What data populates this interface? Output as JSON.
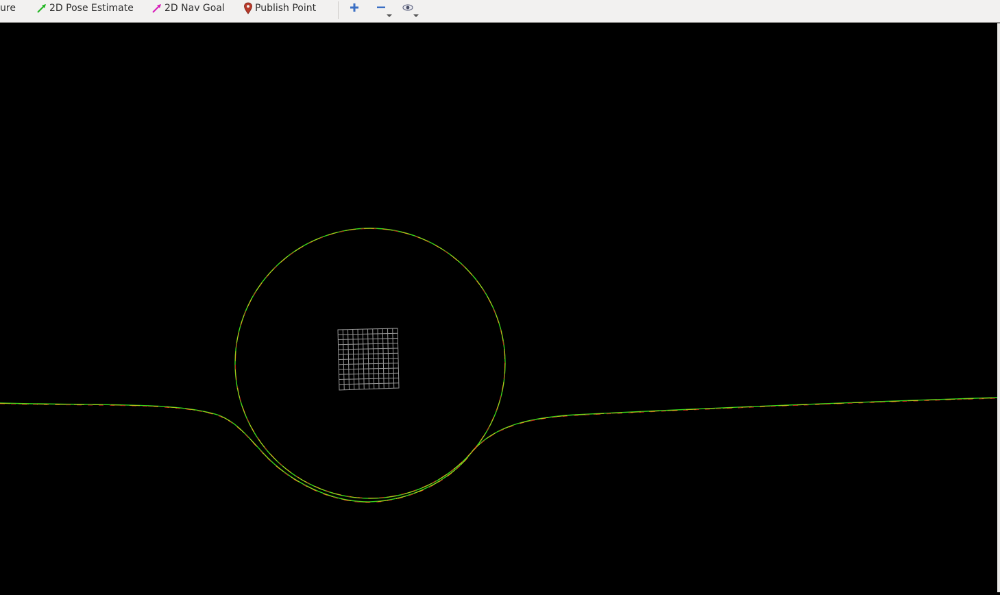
{
  "toolbar": {
    "measure_label_partial": "ure",
    "pose_estimate_label": "2D Pose Estimate",
    "nav_goal_label": "2D Nav Goal",
    "publish_point_label": "Publish Point",
    "icons": {
      "pose_estimate": "green-arrow-icon",
      "nav_goal": "magenta-arrow-icon",
      "publish_point": "location-pin-icon",
      "zoom_in": "plus-icon",
      "zoom_out": "minus-icon",
      "view": "eye-icon"
    }
  },
  "viewport": {
    "background": "#000000",
    "path_colors": {
      "path_a": "#38d81b",
      "path_b": "#c8201a",
      "path_c": "#d4c21c"
    },
    "grid_color": "#9a9a9a"
  }
}
